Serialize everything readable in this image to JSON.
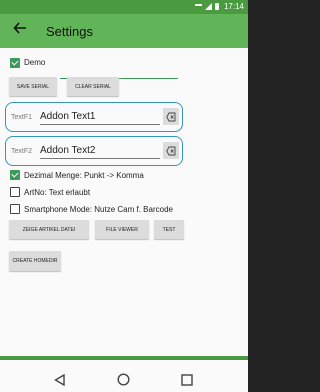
{
  "status_bar": {
    "time": "17:14"
  },
  "app_bar": {
    "title": "Settings"
  },
  "demo": {
    "checked": true,
    "label": "Demo",
    "value": ""
  },
  "buttons": {
    "save_serial": "SAVE SERIAL",
    "clear_serial": "CLEAR SERIAL",
    "zeige_artikel_datei": "ZEIGE ARTIKEL DATEI",
    "file_viewer": "FILE VIEWER",
    "test": "TEST",
    "create_homedir": "CREATE HOMEDIR"
  },
  "text_fields": [
    {
      "label": "TextF1",
      "value": "Addon Text1"
    },
    {
      "label": "TextF2",
      "value": "Addon Text2"
    }
  ],
  "options": [
    {
      "label": "Dezimal Menge: Punkt -> Komma",
      "checked": true
    },
    {
      "label": "ArtNo: Text erlaubt",
      "checked": false
    },
    {
      "label": "Smartphone Mode: Nutze Cam f. Barcode",
      "checked": false
    }
  ],
  "colors": {
    "accent": "#62b458",
    "status_bar": "#4a9a40",
    "field_border": "#3a93b8"
  }
}
